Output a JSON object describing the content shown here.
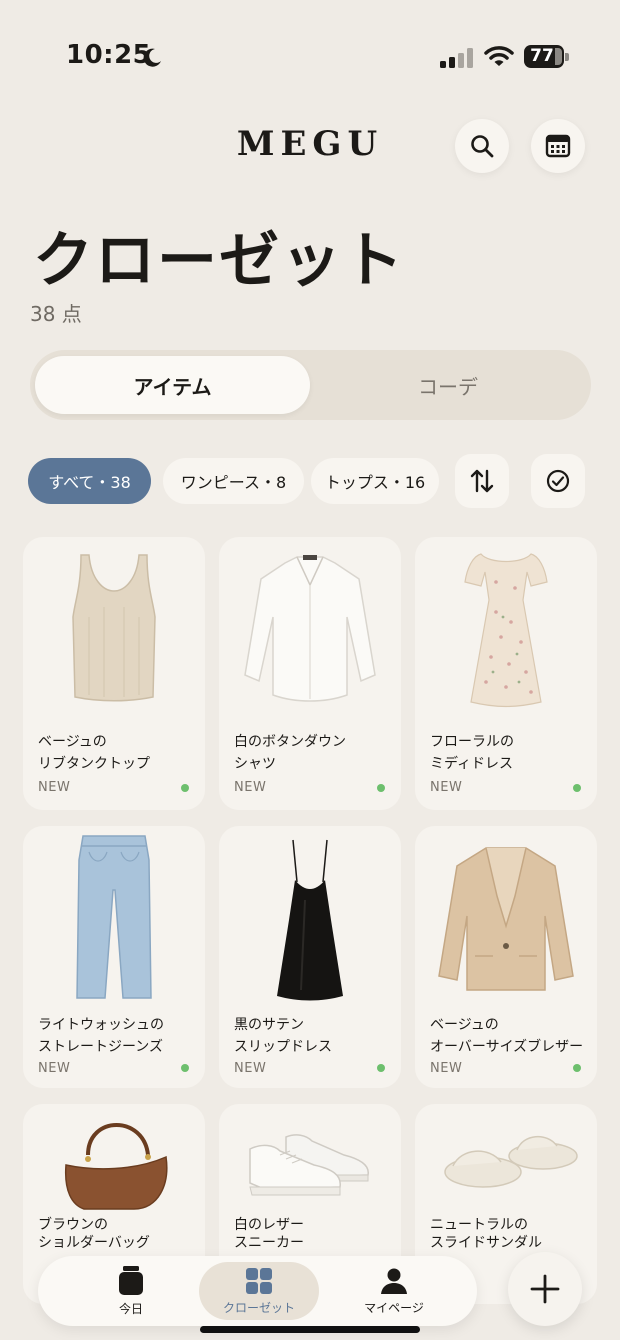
{
  "status_bar": {
    "time": "10:25",
    "battery": "77"
  },
  "header": {
    "logo": "MEGU"
  },
  "page": {
    "title": "クローゼット",
    "count": "38 点"
  },
  "tabs": {
    "active": "アイテム",
    "inactive": "コーデ"
  },
  "filters": {
    "all": "すべて・38",
    "onepiece": "ワンピース・8",
    "tops": "トップス・16"
  },
  "items": [
    {
      "line1": "ベージュの",
      "line2": "リブタンクトップ",
      "tag": "NEW"
    },
    {
      "line1": "白のボタンダウン",
      "line2": "シャツ",
      "tag": "NEW"
    },
    {
      "line1": "フローラルの",
      "line2": "ミディドレス",
      "tag": "NEW"
    },
    {
      "line1": "ライトウォッシュの",
      "line2": "ストレートジーンズ",
      "tag": "NEW"
    },
    {
      "line1": "黒のサテン",
      "line2": "スリップドレス",
      "tag": "NEW"
    },
    {
      "line1": "ベージュの",
      "line2": "オーバーサイズブレザー",
      "tag": "NEW"
    },
    {
      "line1": "ブラウンの",
      "line2": "ショルダーバッグ"
    },
    {
      "line1": "白のレザー",
      "line2": "スニーカー"
    },
    {
      "line1": "ニュートラルの",
      "line2": "スライドサンダル"
    }
  ],
  "nav": {
    "today": "今日",
    "closet": "クローゼット",
    "mypage": "マイページ"
  },
  "colors": {
    "accent": "#5b7697",
    "background": "#efebe5",
    "new_dot": "#6dbf6d"
  }
}
